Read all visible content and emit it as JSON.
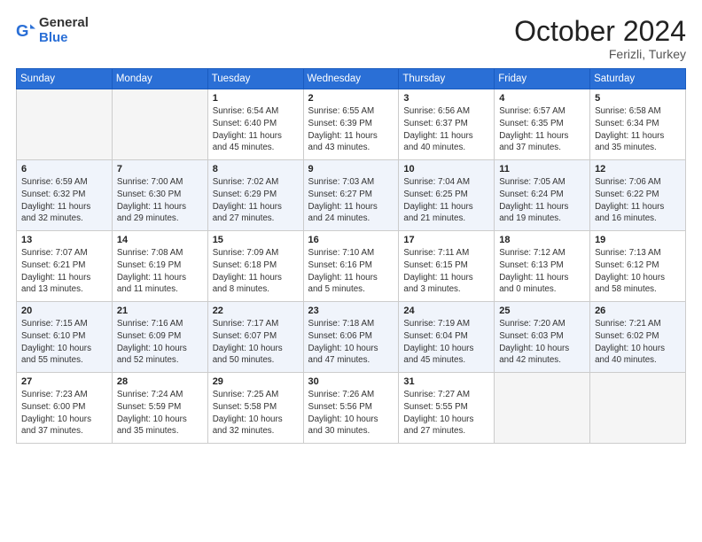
{
  "header": {
    "logo_general": "General",
    "logo_blue": "Blue",
    "month_title": "October 2024",
    "location": "Ferizli, Turkey"
  },
  "days_of_week": [
    "Sunday",
    "Monday",
    "Tuesday",
    "Wednesday",
    "Thursday",
    "Friday",
    "Saturday"
  ],
  "weeks": [
    [
      {
        "day": "",
        "info": ""
      },
      {
        "day": "",
        "info": ""
      },
      {
        "day": "1",
        "info": "Sunrise: 6:54 AM\nSunset: 6:40 PM\nDaylight: 11 hours and 45 minutes."
      },
      {
        "day": "2",
        "info": "Sunrise: 6:55 AM\nSunset: 6:39 PM\nDaylight: 11 hours and 43 minutes."
      },
      {
        "day": "3",
        "info": "Sunrise: 6:56 AM\nSunset: 6:37 PM\nDaylight: 11 hours and 40 minutes."
      },
      {
        "day": "4",
        "info": "Sunrise: 6:57 AM\nSunset: 6:35 PM\nDaylight: 11 hours and 37 minutes."
      },
      {
        "day": "5",
        "info": "Sunrise: 6:58 AM\nSunset: 6:34 PM\nDaylight: 11 hours and 35 minutes."
      }
    ],
    [
      {
        "day": "6",
        "info": "Sunrise: 6:59 AM\nSunset: 6:32 PM\nDaylight: 11 hours and 32 minutes."
      },
      {
        "day": "7",
        "info": "Sunrise: 7:00 AM\nSunset: 6:30 PM\nDaylight: 11 hours and 29 minutes."
      },
      {
        "day": "8",
        "info": "Sunrise: 7:02 AM\nSunset: 6:29 PM\nDaylight: 11 hours and 27 minutes."
      },
      {
        "day": "9",
        "info": "Sunrise: 7:03 AM\nSunset: 6:27 PM\nDaylight: 11 hours and 24 minutes."
      },
      {
        "day": "10",
        "info": "Sunrise: 7:04 AM\nSunset: 6:25 PM\nDaylight: 11 hours and 21 minutes."
      },
      {
        "day": "11",
        "info": "Sunrise: 7:05 AM\nSunset: 6:24 PM\nDaylight: 11 hours and 19 minutes."
      },
      {
        "day": "12",
        "info": "Sunrise: 7:06 AM\nSunset: 6:22 PM\nDaylight: 11 hours and 16 minutes."
      }
    ],
    [
      {
        "day": "13",
        "info": "Sunrise: 7:07 AM\nSunset: 6:21 PM\nDaylight: 11 hours and 13 minutes."
      },
      {
        "day": "14",
        "info": "Sunrise: 7:08 AM\nSunset: 6:19 PM\nDaylight: 11 hours and 11 minutes."
      },
      {
        "day": "15",
        "info": "Sunrise: 7:09 AM\nSunset: 6:18 PM\nDaylight: 11 hours and 8 minutes."
      },
      {
        "day": "16",
        "info": "Sunrise: 7:10 AM\nSunset: 6:16 PM\nDaylight: 11 hours and 5 minutes."
      },
      {
        "day": "17",
        "info": "Sunrise: 7:11 AM\nSunset: 6:15 PM\nDaylight: 11 hours and 3 minutes."
      },
      {
        "day": "18",
        "info": "Sunrise: 7:12 AM\nSunset: 6:13 PM\nDaylight: 11 hours and 0 minutes."
      },
      {
        "day": "19",
        "info": "Sunrise: 7:13 AM\nSunset: 6:12 PM\nDaylight: 10 hours and 58 minutes."
      }
    ],
    [
      {
        "day": "20",
        "info": "Sunrise: 7:15 AM\nSunset: 6:10 PM\nDaylight: 10 hours and 55 minutes."
      },
      {
        "day": "21",
        "info": "Sunrise: 7:16 AM\nSunset: 6:09 PM\nDaylight: 10 hours and 52 minutes."
      },
      {
        "day": "22",
        "info": "Sunrise: 7:17 AM\nSunset: 6:07 PM\nDaylight: 10 hours and 50 minutes."
      },
      {
        "day": "23",
        "info": "Sunrise: 7:18 AM\nSunset: 6:06 PM\nDaylight: 10 hours and 47 minutes."
      },
      {
        "day": "24",
        "info": "Sunrise: 7:19 AM\nSunset: 6:04 PM\nDaylight: 10 hours and 45 minutes."
      },
      {
        "day": "25",
        "info": "Sunrise: 7:20 AM\nSunset: 6:03 PM\nDaylight: 10 hours and 42 minutes."
      },
      {
        "day": "26",
        "info": "Sunrise: 7:21 AM\nSunset: 6:02 PM\nDaylight: 10 hours and 40 minutes."
      }
    ],
    [
      {
        "day": "27",
        "info": "Sunrise: 7:23 AM\nSunset: 6:00 PM\nDaylight: 10 hours and 37 minutes."
      },
      {
        "day": "28",
        "info": "Sunrise: 7:24 AM\nSunset: 5:59 PM\nDaylight: 10 hours and 35 minutes."
      },
      {
        "day": "29",
        "info": "Sunrise: 7:25 AM\nSunset: 5:58 PM\nDaylight: 10 hours and 32 minutes."
      },
      {
        "day": "30",
        "info": "Sunrise: 7:26 AM\nSunset: 5:56 PM\nDaylight: 10 hours and 30 minutes."
      },
      {
        "day": "31",
        "info": "Sunrise: 7:27 AM\nSunset: 5:55 PM\nDaylight: 10 hours and 27 minutes."
      },
      {
        "day": "",
        "info": ""
      },
      {
        "day": "",
        "info": ""
      }
    ]
  ]
}
